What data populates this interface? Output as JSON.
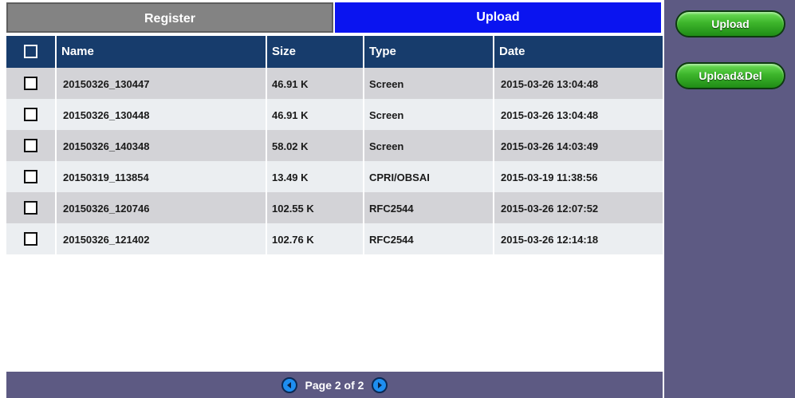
{
  "tabs": {
    "register": "Register",
    "upload": "Upload"
  },
  "table": {
    "columns": {
      "name": "Name",
      "size": "Size",
      "type": "Type",
      "date": "Date"
    },
    "rows": [
      {
        "name": "20150326_130447",
        "size": "46.91 K",
        "type": "Screen",
        "date": "2015-03-26 13:04:48"
      },
      {
        "name": "20150326_130448",
        "size": "46.91 K",
        "type": "Screen",
        "date": "2015-03-26 13:04:48"
      },
      {
        "name": "20150326_140348",
        "size": "58.02 K",
        "type": "Screen",
        "date": "2015-03-26 14:03:49"
      },
      {
        "name": "20150319_113854",
        "size": "13.49 K",
        "type": "CPRI/OBSAI",
        "date": "2015-03-19 11:38:56"
      },
      {
        "name": "20150326_120746",
        "size": "102.55 K",
        "type": "RFC2544",
        "date": "2015-03-26 12:07:52"
      },
      {
        "name": "20150326_121402",
        "size": "102.76 K",
        "type": "RFC2544",
        "date": "2015-03-26 12:14:18"
      }
    ]
  },
  "pager": {
    "label": "Page 2 of 2"
  },
  "actions": {
    "upload": "Upload",
    "upload_del": "Upload&Del"
  },
  "icons": {
    "prev": "left-arrow-circle-icon",
    "next": "right-arrow-circle-icon"
  },
  "colors": {
    "active_tab": "#0a14f0",
    "header": "#173c6c",
    "panel": "#5d5a83",
    "button": "#3db52b"
  }
}
